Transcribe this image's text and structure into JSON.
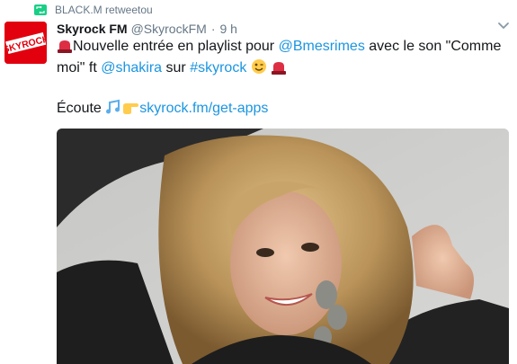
{
  "retweet": {
    "icon": "retweet-icon",
    "label": "BLACK.M retweetou",
    "color": "#19cf86"
  },
  "avatar": {
    "icon": "skyrock-logo",
    "logo_text": "SKYROCK",
    "color": "#e2000f"
  },
  "tweet": {
    "author_name": "Skyrock FM",
    "author_handle": "@SkyrockFM",
    "separator": "·",
    "time": "9 h",
    "line1_pre": "Nouvelle entrée en playlist pour ",
    "mention1": "@Bmesrimes",
    "line1_mid": " avec le son \"Comme moi\" ft ",
    "mention2": "@shakira",
    "line1_sur": " sur ",
    "hashtag": "#skyrock",
    "listen": "Écoute ",
    "link": "skyrock.fm/get-apps",
    "link_color": "#1b95e0"
  },
  "media": {
    "description_icon": "photo"
  }
}
